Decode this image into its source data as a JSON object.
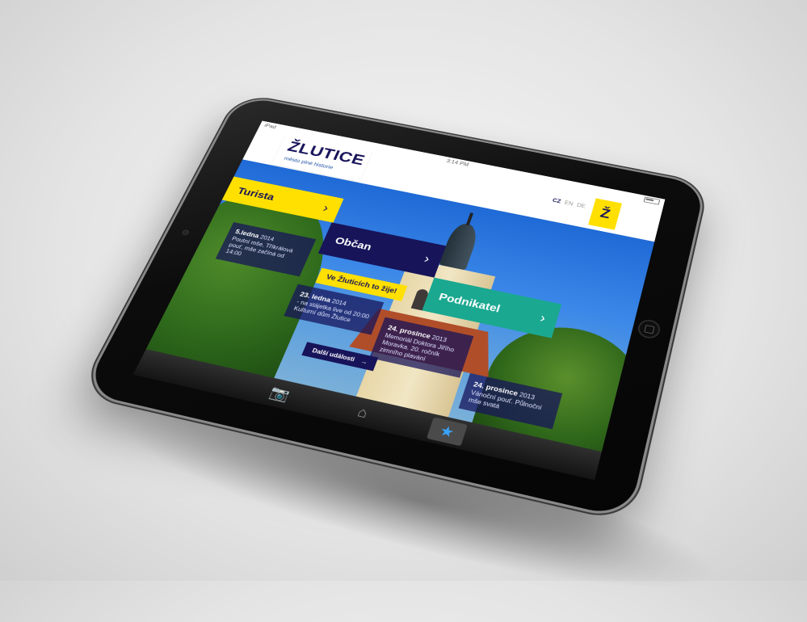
{
  "status_bar": {
    "carrier": "iPad",
    "time": "3:14 PM"
  },
  "site": {
    "logo_title": "ŽLUTICE",
    "logo_subtitle": "město plné historie",
    "badge_letter": "Ž"
  },
  "languages": {
    "items": [
      "CZ",
      "EN",
      "DE"
    ],
    "active": "CZ"
  },
  "categories": [
    {
      "label": "Turista",
      "color": "#ffe000"
    },
    {
      "label": "Občan",
      "color": "#17145a"
    },
    {
      "label": "Podnikatel",
      "color": "#1aa890"
    }
  ],
  "tagline": "Ve Žluticích to žije!",
  "events": [
    {
      "date": "5.ledna",
      "year": "2014",
      "text": "Poutní mše, Tříkrálová pouť, mše začíná od 14:00"
    },
    {
      "date": "23. ledna",
      "year": "2014",
      "text": "- na stájetka live od 20:00 Kulturní dům Žlutice"
    },
    {
      "date": "24. prosince",
      "year": "2013",
      "text": "Memoriál Doktora Jiřího Moravka. 20. ročník zimního plavání"
    },
    {
      "date": "24. prosince",
      "year": "2013",
      "text": "Vánoční pouť. Půlnoční mše svatá"
    }
  ],
  "more_button": {
    "label": "Další události",
    "arrow": "→"
  },
  "tabbar": {
    "items": [
      {
        "icon": "camera-icon",
        "glyph": "📷"
      },
      {
        "icon": "home-icon",
        "glyph": "⌂"
      },
      {
        "icon": "star-icon",
        "glyph": "★"
      }
    ],
    "active_index": 2
  },
  "colors": {
    "brand_navy": "#17145a",
    "brand_yellow": "#ffe000",
    "brand_teal": "#1aa890",
    "tab_active": "#38a4ff"
  }
}
